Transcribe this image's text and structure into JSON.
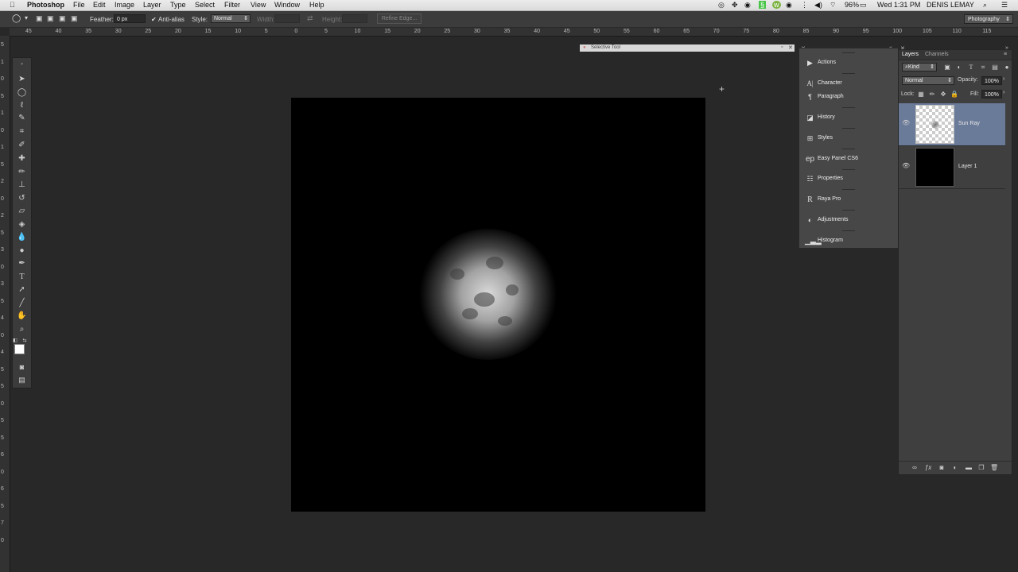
{
  "menubar": {
    "apple": "",
    "app": "Photoshop",
    "items": [
      "File",
      "Edit",
      "Image",
      "Layer",
      "Type",
      "Select",
      "Filter",
      "View",
      "Window",
      "Help"
    ],
    "battery": "96%",
    "clock": "Wed 1:31 PM",
    "user": "DENIS LEMAY"
  },
  "options": {
    "feather_label": "Feather:",
    "feather_value": "0 px",
    "antialias_label": "Anti-alias",
    "style_label": "Style:",
    "style_value": "Normal",
    "width_label": "Width:",
    "height_label": "Height:",
    "refine_label": "Refine Edge...",
    "workspace": "Photography"
  },
  "ruler": {
    "h_labels": [
      "45",
      "40",
      "35",
      "30",
      "25",
      "20",
      "15",
      "10",
      "5",
      "0",
      "5",
      "10",
      "15",
      "20",
      "25",
      "30",
      "35",
      "40",
      "45",
      "50",
      "55",
      "60",
      "65",
      "70",
      "75",
      "80",
      "85",
      "90",
      "95",
      "100",
      "105",
      "110",
      "115"
    ],
    "v_labels": [
      "5",
      "1",
      "0",
      "5",
      "1",
      "0",
      "1",
      "5",
      "2",
      "0",
      "2",
      "5",
      "3",
      "0",
      "3",
      "5",
      "4",
      "0",
      "4",
      "5",
      "5",
      "0",
      "5",
      "5",
      "6",
      "0",
      "6",
      "5",
      "7",
      "0"
    ]
  },
  "selective_panel": {
    "title": "Selective Tool"
  },
  "dock": {
    "items": [
      {
        "label": "Actions",
        "icon": "play-icon"
      },
      {
        "label": "Character",
        "icon": "character-icon"
      },
      {
        "label": "Paragraph",
        "icon": "paragraph-icon"
      },
      {
        "label": "History",
        "icon": "history-icon"
      },
      {
        "label": "Styles",
        "icon": "styles-icon"
      },
      {
        "label": "Easy Panel CS6",
        "icon": "ep-icon"
      },
      {
        "label": "Properties",
        "icon": "properties-icon"
      },
      {
        "label": "Raya Pro",
        "icon": "raya-icon"
      },
      {
        "label": "Adjustments",
        "icon": "adjustments-icon"
      },
      {
        "label": "Histogram",
        "icon": "histogram-icon"
      }
    ]
  },
  "layers": {
    "tabs": [
      "Layers",
      "Channels"
    ],
    "filter_kind": "Kind",
    "blend_mode": "Normal",
    "opacity_label": "Opacity:",
    "opacity_value": "100%",
    "lock_label": "Lock:",
    "fill_label": "Fill:",
    "fill_value": "100%",
    "items": [
      {
        "name": "Sun Ray",
        "selected": true
      },
      {
        "name": "Layer 1",
        "selected": false
      }
    ]
  },
  "colors": {
    "selected_layer": "#6a7a99",
    "panel_bg": "#3f3f3f",
    "workspace_bg": "#282828"
  }
}
